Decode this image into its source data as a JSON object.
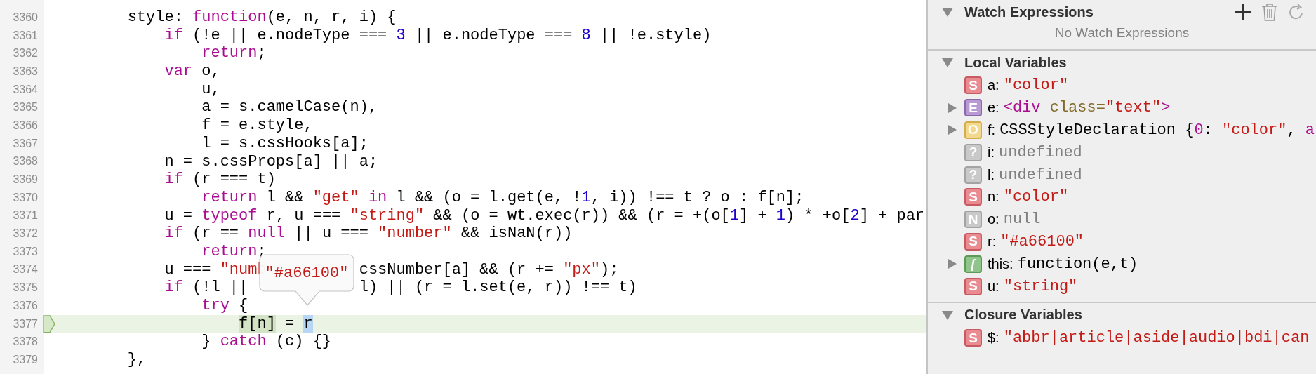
{
  "editor": {
    "lines": [
      {
        "number": "3360",
        "current": false,
        "tokens": [
          {
            "kind": "plain",
            "text": "        style: "
          },
          {
            "kind": "keyword",
            "text": "function"
          },
          {
            "kind": "plain",
            "text": "(e, n, r, i) {"
          }
        ]
      },
      {
        "number": "3361",
        "current": false,
        "tokens": [
          {
            "kind": "keyword",
            "text": "            if"
          },
          {
            "kind": "plain",
            "text": " (!e || e.nodeType === "
          },
          {
            "kind": "number",
            "text": "3"
          },
          {
            "kind": "plain",
            "text": " || e.nodeType === "
          },
          {
            "kind": "number",
            "text": "8"
          },
          {
            "kind": "plain",
            "text": " || !e.style)"
          }
        ]
      },
      {
        "number": "3362",
        "current": false,
        "tokens": [
          {
            "kind": "keyword",
            "text": "                return"
          },
          {
            "kind": "plain",
            "text": ";"
          }
        ]
      },
      {
        "number": "3363",
        "current": false,
        "tokens": [
          {
            "kind": "keyword",
            "text": "            var"
          },
          {
            "kind": "plain",
            "text": " o,"
          }
        ]
      },
      {
        "number": "3364",
        "current": false,
        "tokens": [
          {
            "kind": "plain",
            "text": "                u,"
          }
        ]
      },
      {
        "number": "3365",
        "current": false,
        "tokens": [
          {
            "kind": "plain",
            "text": "                a = s.camelCase(n),"
          }
        ]
      },
      {
        "number": "3366",
        "current": false,
        "tokens": [
          {
            "kind": "plain",
            "text": "                f = e.style,"
          }
        ]
      },
      {
        "number": "3367",
        "current": false,
        "tokens": [
          {
            "kind": "plain",
            "text": "                l = s.cssHooks[a];"
          }
        ]
      },
      {
        "number": "3368",
        "current": false,
        "tokens": [
          {
            "kind": "plain",
            "text": "            n = s.cssProps[a] || a;"
          }
        ]
      },
      {
        "number": "3369",
        "current": false,
        "tokens": [
          {
            "kind": "keyword",
            "text": "            if"
          },
          {
            "kind": "plain",
            "text": " (r === t)"
          }
        ]
      },
      {
        "number": "3370",
        "current": false,
        "tokens": [
          {
            "kind": "keyword",
            "text": "                return"
          },
          {
            "kind": "plain",
            "text": " l && "
          },
          {
            "kind": "string",
            "text": "\"get\""
          },
          {
            "kind": "keyword",
            "text": " in"
          },
          {
            "kind": "plain",
            "text": " l && (o = l.get(e, !"
          },
          {
            "kind": "number",
            "text": "1"
          },
          {
            "kind": "plain",
            "text": ", i)) !== t ? o : f[n];"
          }
        ]
      },
      {
        "number": "3371",
        "current": false,
        "tokens": [
          {
            "kind": "plain",
            "text": "            u = "
          },
          {
            "kind": "keyword",
            "text": "typeof"
          },
          {
            "kind": "plain",
            "text": " r, u === "
          },
          {
            "kind": "string",
            "text": "\"string\""
          },
          {
            "kind": "plain",
            "text": " && (o = wt.exec(r)) && (r = +(o["
          },
          {
            "kind": "number",
            "text": "1"
          },
          {
            "kind": "plain",
            "text": "] + "
          },
          {
            "kind": "number",
            "text": "1"
          },
          {
            "kind": "plain",
            "text": ") * +o["
          },
          {
            "kind": "number",
            "text": "2"
          },
          {
            "kind": "plain",
            "text": "] + par"
          }
        ]
      },
      {
        "number": "3372",
        "current": false,
        "tokens": [
          {
            "kind": "keyword",
            "text": "            if"
          },
          {
            "kind": "plain",
            "text": " (r == "
          },
          {
            "kind": "keyword",
            "text": "null"
          },
          {
            "kind": "plain",
            "text": " || u === "
          },
          {
            "kind": "string",
            "text": "\"number\""
          },
          {
            "kind": "plain",
            "text": " && isNaN(r))"
          }
        ]
      },
      {
        "number": "3373",
        "current": false,
        "tokens": [
          {
            "kind": "keyword",
            "text": "                return"
          },
          {
            "kind": "plain",
            "text": ";"
          }
        ]
      },
      {
        "number": "3374",
        "current": false,
        "tokens": [
          {
            "kind": "plain",
            "text": "            u === "
          },
          {
            "kind": "string",
            "text": "\"numb"
          }
        ],
        "tokens_after_popover": [
          {
            "kind": "plain",
            "text": "cssNumber[a] && (r += "
          },
          {
            "kind": "string",
            "text": "\"px\""
          },
          {
            "kind": "plain",
            "text": ");"
          }
        ]
      },
      {
        "number": "3375",
        "current": false,
        "tokens": [
          {
            "kind": "keyword",
            "text": "            if"
          },
          {
            "kind": "plain",
            "text": " (!l || "
          }
        ],
        "tokens_after_popover": [
          {
            "kind": "plain",
            "text": "l) || (r = l.set(e, r)) !== t)"
          }
        ]
      },
      {
        "number": "3376",
        "current": false,
        "tokens": [
          {
            "kind": "keyword",
            "text": "                try"
          },
          {
            "kind": "plain",
            "text": " {"
          }
        ]
      },
      {
        "number": "3377",
        "current": true,
        "tokens": [
          {
            "kind": "match",
            "text": "                    f[n]"
          },
          {
            "kind": "plain",
            "text": " = "
          },
          {
            "kind": "hover",
            "text": "r"
          }
        ]
      },
      {
        "number": "3378",
        "current": false,
        "tokens": [
          {
            "kind": "plain",
            "text": "                } "
          },
          {
            "kind": "keyword",
            "text": "catch"
          },
          {
            "kind": "plain",
            "text": " (c) {}"
          }
        ]
      },
      {
        "number": "3379",
        "current": false,
        "tokens": [
          {
            "kind": "plain",
            "text": "        },"
          }
        ]
      }
    ],
    "popover": {
      "value": "\"#a66100\""
    }
  },
  "sidebar": {
    "sections": [
      {
        "title": "Watch Expressions",
        "expanded": true,
        "kind": "watch",
        "empty_text": "No Watch Expressions"
      },
      {
        "title": "Local Variables",
        "expanded": true,
        "kind": "variables",
        "variables": [
          {
            "kind": "string",
            "badge": "S",
            "name": "a:",
            "expandable": false,
            "value": [
              {
                "kind": "string",
                "text": "\"color\""
              }
            ]
          },
          {
            "kind": "element",
            "badge": "E",
            "name": "e:",
            "expandable": true,
            "value": [
              {
                "kind": "tag",
                "text": "<div"
              },
              {
                "kind": "attr",
                "text": " class="
              },
              {
                "kind": "string",
                "text": "\"text\""
              },
              {
                "kind": "tag",
                "text": ">"
              }
            ]
          },
          {
            "kind": "object",
            "badge": "O",
            "name": "f:",
            "expandable": true,
            "value": [
              {
                "kind": "plain",
                "text": "CSSStyleDeclaration {"
              },
              {
                "kind": "key",
                "text": "0"
              },
              {
                "kind": "plain",
                "text": ": "
              },
              {
                "kind": "string",
                "text": "\"color\""
              },
              {
                "kind": "plain",
                "text": ", "
              },
              {
                "kind": "key",
                "text": "a"
              }
            ]
          },
          {
            "kind": "undefined",
            "badge": "?",
            "name": "i:",
            "expandable": false,
            "value": [
              {
                "kind": "gray",
                "text": "undefined"
              }
            ]
          },
          {
            "kind": "undefined",
            "badge": "?",
            "name": "l:",
            "expandable": false,
            "value": [
              {
                "kind": "gray",
                "text": "undefined"
              }
            ]
          },
          {
            "kind": "string",
            "badge": "S",
            "name": "n:",
            "expandable": false,
            "value": [
              {
                "kind": "string",
                "text": "\"color\""
              }
            ]
          },
          {
            "kind": "null",
            "badge": "N",
            "name": "o:",
            "expandable": false,
            "value": [
              {
                "kind": "gray",
                "text": "null"
              }
            ]
          },
          {
            "kind": "string",
            "badge": "S",
            "name": "r:",
            "expandable": false,
            "value": [
              {
                "kind": "string",
                "text": "\"#a66100\""
              }
            ]
          },
          {
            "kind": "function",
            "badge": "f",
            "name": "this:",
            "expandable": true,
            "value": [
              {
                "kind": "plain",
                "text": "function(e,t)"
              }
            ]
          },
          {
            "kind": "string",
            "badge": "S",
            "name": "u:",
            "expandable": false,
            "value": [
              {
                "kind": "string",
                "text": "\"string\""
              }
            ]
          }
        ]
      },
      {
        "title": "Closure Variables",
        "expanded": true,
        "kind": "variables",
        "variables": [
          {
            "kind": "string",
            "badge": "S",
            "name": "$:",
            "expandable": false,
            "value": [
              {
                "kind": "string",
                "text": "\"abbr|article|aside|audio|bdi|can"
              }
            ]
          }
        ]
      }
    ]
  }
}
